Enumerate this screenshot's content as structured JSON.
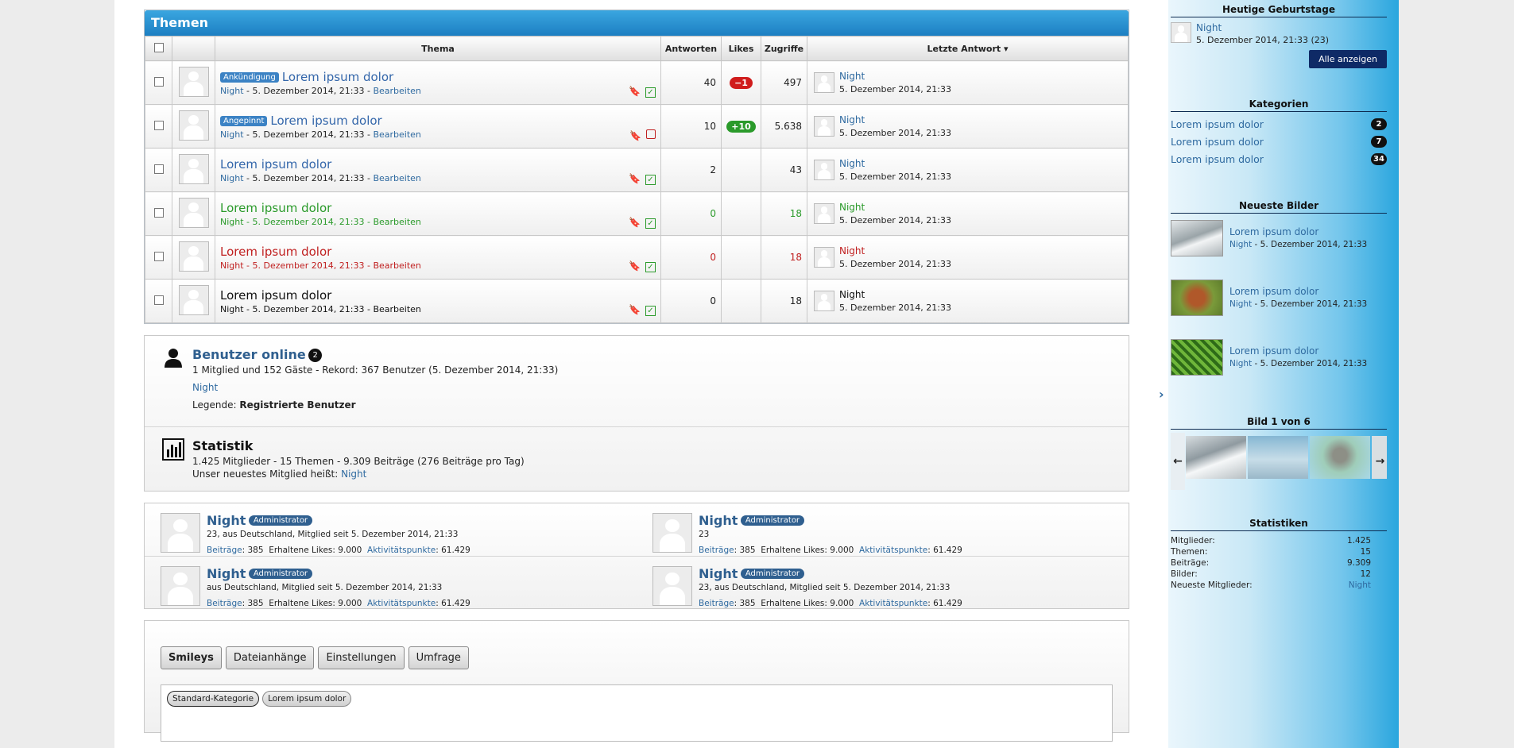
{
  "topics": {
    "title": "Themen",
    "headers": {
      "thema": "Thema",
      "antworten": "Antworten",
      "likes": "Likes",
      "zugriffe": "Zugriffe",
      "letzte": "Letzte Antwort"
    },
    "rows": [
      {
        "tag": "Ankündigung",
        "title": "Lorem ipsum dolor",
        "author": "Night",
        "date": " - 5. Dezember 2014, 21:33 - ",
        "edit": "Bearbeiten",
        "answers": "40",
        "likes": "−1",
        "likes_color": "#d01c1c",
        "views": "497",
        "last_user": "Night",
        "last_date": "5. Dezember 2014, 21:33",
        "color": "blue",
        "status": "check"
      },
      {
        "tag": "Angepinnt",
        "title": "Lorem ipsum dolor",
        "author": "Night",
        "date": " - 5. Dezember 2014, 21:33 - ",
        "edit": "Bearbeiten",
        "answers": "10",
        "likes": "+10",
        "likes_color": "#2a9a2a",
        "views": "5.638",
        "last_user": "Night",
        "last_date": "5. Dezember 2014, 21:33",
        "color": "blue",
        "status": "box"
      },
      {
        "tag": "",
        "title": "Lorem ipsum dolor",
        "author": "Night",
        "date": " - 5. Dezember 2014, 21:33 - ",
        "edit": "Bearbeiten",
        "answers": "2",
        "likes": "",
        "likes_color": "",
        "views": "43",
        "last_user": "Night",
        "last_date": "5. Dezember 2014, 21:33",
        "color": "blue",
        "status": "check"
      },
      {
        "tag": "",
        "title": "Lorem ipsum dolor",
        "author": "Night",
        "date": " - 5. Dezember 2014, 21:33 - ",
        "edit": "Bearbeiten",
        "answers": "0",
        "likes": "",
        "likes_color": "",
        "views": "18",
        "last_user": "Night",
        "last_date": "5. Dezember 2014, 21:33",
        "color": "green",
        "status": "check"
      },
      {
        "tag": "",
        "title": "Lorem ipsum dolor",
        "author": "Night",
        "date": " - 5. Dezember 2014, 21:33 - ",
        "edit": "Bearbeiten",
        "answers": "0",
        "likes": "",
        "likes_color": "",
        "views": "18",
        "last_user": "Night",
        "last_date": "5. Dezember 2014, 21:33",
        "color": "red",
        "status": "check"
      },
      {
        "tag": "",
        "title": "Lorem ipsum dolor",
        "author": "Night",
        "date": " - 5. Dezember 2014, 21:33 - ",
        "edit": "Bearbeiten",
        "answers": "0",
        "likes": "",
        "likes_color": "",
        "views": "18",
        "last_user": "Night",
        "last_date": "5. Dezember 2014, 21:33",
        "color": "black",
        "status": "check"
      }
    ]
  },
  "online": {
    "title": "Benutzer online",
    "count": "2",
    "summary": "1 Mitglied und 152 Gäste - Rekord: 367 Benutzer (5. Dezember 2014, 21:33)",
    "user": "Night",
    "legend_label": "Legende: ",
    "legend_value": "Registrierte Benutzer"
  },
  "stats": {
    "title": "Statistik",
    "line1": "1.425 Mitglieder - 15 Themen - 9.309 Beiträge (276 Beiträge pro Tag)",
    "line2": "Unser neuestes Mitglied heißt: ",
    "newest": "Night"
  },
  "members": [
    {
      "name": "Night",
      "role": "Administrator",
      "info": "23, aus Deutschland, Mitglied seit 5. Dezember 2014, 21:33",
      "posts_label": "Beiträge",
      "posts": ": 385",
      "likes": "Erhaltene Likes: 9.000",
      "points_label": "Aktivitätspunkte",
      "points": ": 61.429"
    },
    {
      "name": "Night",
      "role": "Administrator",
      "info": "23",
      "posts_label": "Beiträge",
      "posts": ": 385",
      "likes": "Erhaltene Likes: 9.000",
      "points_label": "Aktivitätspunkte",
      "points": ": 61.429"
    },
    {
      "name": "Night",
      "role": "Administrator",
      "info": "aus Deutschland, Mitglied seit 5. Dezember 2014, 21:33",
      "posts_label": "Beiträge",
      "posts": ": 385",
      "likes": "Erhaltene Likes: 9.000",
      "points_label": "Aktivitätspunkte",
      "points": ": 61.429"
    },
    {
      "name": "Night",
      "role": "Administrator",
      "info": "23, aus Deutschland, Mitglied seit 5. Dezember 2014, 21:33",
      "posts_label": "Beiträge",
      "posts": ": 385",
      "likes": "Erhaltene Likes: 9.000",
      "points_label": "Aktivitätspunkte",
      "points": ": 61.429"
    }
  ],
  "editor": {
    "tabs": [
      "Smileys",
      "Dateianhänge",
      "Einstellungen",
      "Umfrage"
    ],
    "chips": [
      "Standard-Kategorie",
      "Lorem ipsum dolor"
    ]
  },
  "sidebar": {
    "birthdays": {
      "title": "Heutige Geburtstage",
      "user": "Night",
      "info": "5. Dezember 2014, 21:33 (23)",
      "button": "Alle anzeigen"
    },
    "categories": {
      "title": "Kategorien",
      "items": [
        {
          "label": "Lorem ipsum dolor",
          "count": "2"
        },
        {
          "label": "Lorem ipsum dolor",
          "count": "7"
        },
        {
          "label": "Lorem ipsum dolor",
          "count": "34"
        }
      ]
    },
    "images": {
      "title": "Neueste Bilder",
      "items": [
        {
          "title": "Lorem ipsum dolor",
          "author": "Night",
          "date": " - 5. Dezember 2014, 21:33"
        },
        {
          "title": "Lorem ipsum dolor",
          "author": "Night",
          "date": " - 5. Dezember 2014, 21:33"
        },
        {
          "title": "Lorem ipsum dolor",
          "author": "Night",
          "date": " - 5. Dezember 2014, 21:33"
        }
      ]
    },
    "slider": {
      "title": "Bild 1 von 6"
    },
    "statistics": {
      "title": "Statistiken",
      "rows": [
        {
          "label": "Mitglieder:",
          "value": "1.425"
        },
        {
          "label": "Themen:",
          "value": "15"
        },
        {
          "label": "Beiträge:",
          "value": "9.309"
        },
        {
          "label": "Bilder:",
          "value": "12"
        },
        {
          "label": "Neueste Mitglieder:",
          "value": "Night"
        }
      ]
    }
  }
}
